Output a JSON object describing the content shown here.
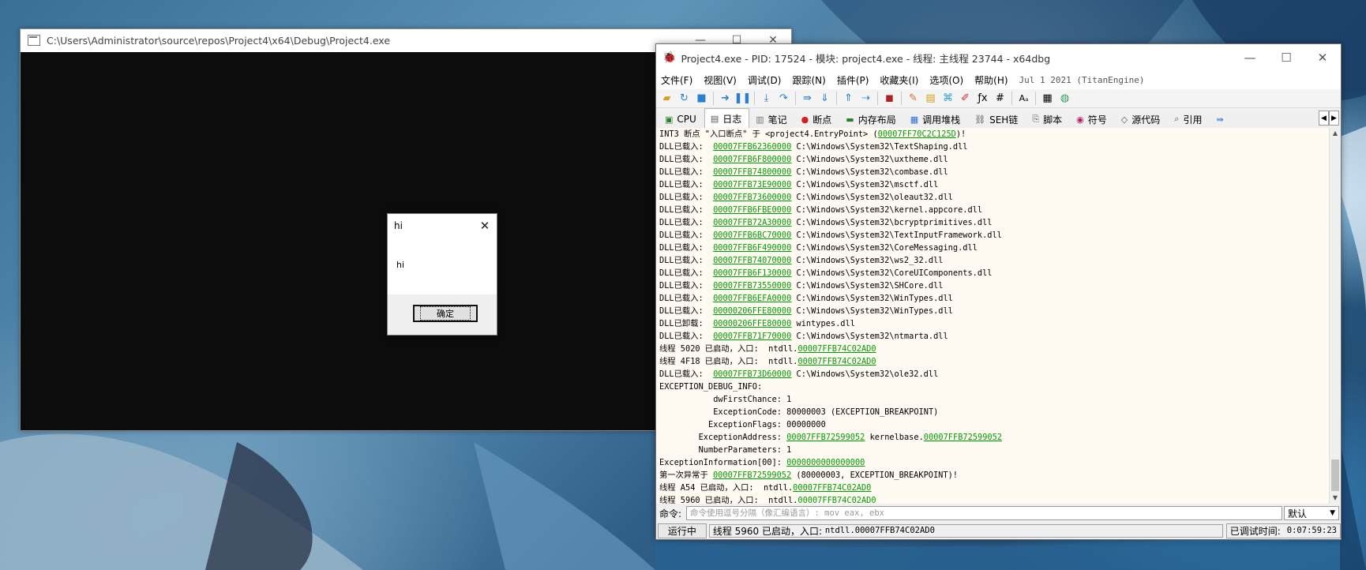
{
  "console": {
    "title": "C:\\Users\\Administrator\\source\\repos\\Project4\\x64\\Debug\\Project4.exe"
  },
  "msgbox": {
    "title": "hi",
    "text": "hi",
    "ok": "确定"
  },
  "window_controls": {
    "minimize": "—",
    "maximize": "☐",
    "close": "✕"
  },
  "dbg": {
    "title": "Project4.exe - PID: 17524 - 模块: project4.exe - 线程: 主线程 23744 - x64dbg",
    "menus": [
      "文件(F)",
      "视图(V)",
      "调试(D)",
      "跟踪(N)",
      "插件(P)",
      "收藏夹(I)",
      "选项(O)",
      "帮助(H)"
    ],
    "version": "Jul 1 2021 (TitanEngine)",
    "tabs": [
      {
        "label": "CPU",
        "icon": "▣"
      },
      {
        "label": "日志",
        "icon": "▤"
      },
      {
        "label": "笔记",
        "icon": "▥"
      },
      {
        "label": "断点",
        "icon": "●"
      },
      {
        "label": "内存布局",
        "icon": "▬"
      },
      {
        "label": "调用堆栈",
        "icon": "▦"
      },
      {
        "label": "SEH链",
        "icon": "⛓"
      },
      {
        "label": "脚本",
        "icon": "⎘"
      },
      {
        "label": "符号",
        "icon": "◉"
      },
      {
        "label": "源代码",
        "icon": "◇"
      },
      {
        "label": "引用",
        "icon": "⌕"
      }
    ],
    "colors": {
      "address": "#00a000",
      "log_bg": "#fffaf2"
    },
    "log": [
      {
        "text": "INT3 断点 \"入口断点\" 于 <project4.EntryPoint> (",
        "addr": "00007FF70C2C125D",
        "text2": ")!"
      },
      {
        "text": "DLL已载入:  ",
        "addr": "00007FFB62360000",
        "text2": " C:\\Windows\\System32\\TextShaping.dll"
      },
      {
        "text": "DLL已载入:  ",
        "addr": "00007FFB6F800000",
        "text2": " C:\\Windows\\System32\\uxtheme.dll"
      },
      {
        "text": "DLL已载入:  ",
        "addr": "00007FFB74800000",
        "text2": " C:\\Windows\\System32\\combase.dll"
      },
      {
        "text": "DLL已载入:  ",
        "addr": "00007FFB73E90000",
        "text2": " C:\\Windows\\System32\\msctf.dll"
      },
      {
        "text": "DLL已载入:  ",
        "addr": "00007FFB73600000",
        "text2": " C:\\Windows\\System32\\oleaut32.dll"
      },
      {
        "text": "DLL已载入:  ",
        "addr": "00007FFB6FBE0000",
        "text2": " C:\\Windows\\System32\\kernel.appcore.dll"
      },
      {
        "text": "DLL已载入:  ",
        "addr": "00007FFB72A30000",
        "text2": " C:\\Windows\\System32\\bcryptprimitives.dll"
      },
      {
        "text": "DLL已载入:  ",
        "addr": "00007FFB6BC70000",
        "text2": " C:\\Windows\\System32\\TextInputFramework.dll"
      },
      {
        "text": "DLL已载入:  ",
        "addr": "00007FFB6F490000",
        "text2": " C:\\Windows\\System32\\CoreMessaging.dll"
      },
      {
        "text": "DLL已载入:  ",
        "addr": "00007FFB74070000",
        "text2": " C:\\Windows\\System32\\ws2_32.dll"
      },
      {
        "text": "DLL已载入:  ",
        "addr": "00007FFB6F130000",
        "text2": " C:\\Windows\\System32\\CoreUIComponents.dll"
      },
      {
        "text": "DLL已载入:  ",
        "addr": "00007FFB73550000",
        "text2": " C:\\Windows\\System32\\SHCore.dll"
      },
      {
        "text": "DLL已载入:  ",
        "addr": "00007FFB6EFA0000",
        "text2": " C:\\Windows\\System32\\WinTypes.dll"
      },
      {
        "text": "DLL已载入:  ",
        "addr": "00000206FFE80000",
        "text2": " C:\\Windows\\System32\\WinTypes.dll"
      },
      {
        "text": "DLL已卸载:  ",
        "addr": "00000206FFE80000",
        "text2": " wintypes.dll"
      },
      {
        "text": "DLL已载入:  ",
        "addr": "00007FFB71F70000",
        "text2": " C:\\Windows\\System32\\ntmarta.dll"
      },
      {
        "text": "线程 5020 已启动，入口:  ntdll.",
        "addr": "00007FFB74C02AD0",
        "text2": ""
      },
      {
        "text": "线程 4F18 已启动，入口:  ntdll.",
        "addr": "00007FFB74C02AD0",
        "text2": ""
      },
      {
        "text": "DLL已载入:  ",
        "addr": "00007FFB73D60000",
        "text2": " C:\\Windows\\System32\\ole32.dll"
      },
      {
        "text": "EXCEPTION_DEBUG_INFO:",
        "addr": "",
        "text2": ""
      },
      {
        "text": "           dwFirstChance: 1",
        "addr": "",
        "text2": ""
      },
      {
        "text": "           ExceptionCode: 80000003 (EXCEPTION_BREAKPOINT)",
        "addr": "",
        "text2": ""
      },
      {
        "text": "          ExceptionFlags: 00000000",
        "addr": "",
        "text2": ""
      },
      {
        "text": "        ExceptionAddress: ",
        "addr": "00007FFB72599052",
        "text2": " kernelbase.",
        "addr2": "00007FFB72599052"
      },
      {
        "text": "        NumberParameters: 1",
        "addr": "",
        "text2": ""
      },
      {
        "text": "ExceptionInformation[00]: ",
        "addr": "0000000000000000",
        "text2": ""
      },
      {
        "text": "第一次异常于 ",
        "addr": "00007FFB72599052",
        "text2": " (80000003, EXCEPTION_BREAKPOINT)!"
      },
      {
        "text": "线程 A54 已启动，入口:  ntdll.",
        "addr": "00007FFB74C02AD0",
        "text2": ""
      },
      {
        "text": "线程 5960 已启动，入口:  ntdll.",
        "addr": "00007FFB74C02AD0",
        "text2": ""
      }
    ],
    "command": {
      "label": "命令:",
      "placeholder": "命令使用逗号分隔（像汇编语言）: mov eax, ebx",
      "mode": "默认"
    },
    "status": {
      "state": "运行中",
      "message_prefix": "线程 5960 已启动，入口:",
      "message_value": "ntdll.00007FFB74C02AD0",
      "time_label": "已调试时间:",
      "time_value": "0:07:59:23"
    }
  }
}
